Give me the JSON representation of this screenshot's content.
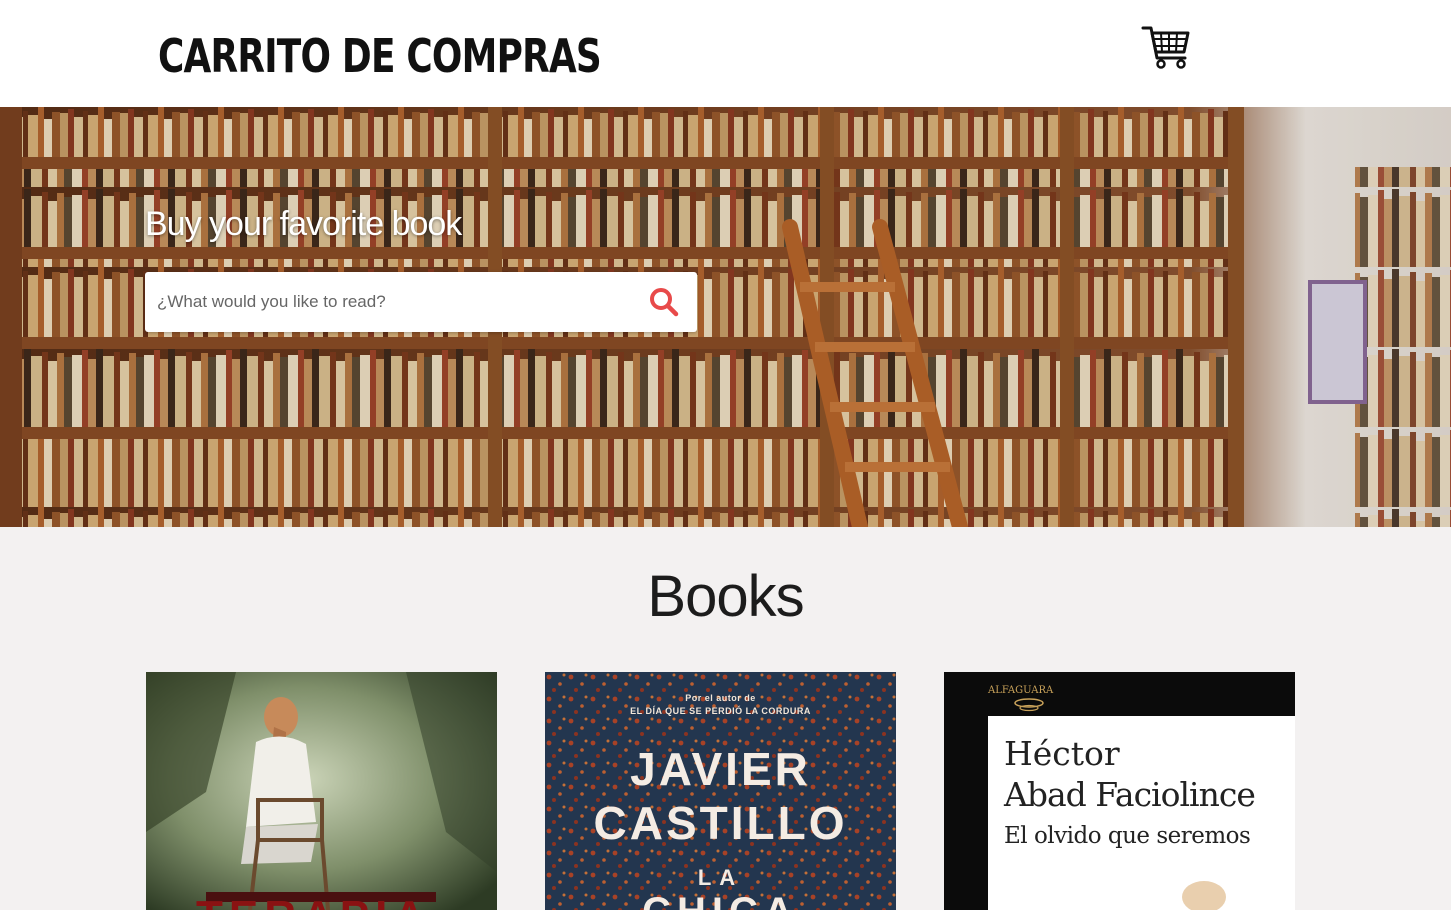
{
  "header": {
    "logo_text": "CARRITO DE COMPRAS",
    "cart_icon": "shopping-cart-icon"
  },
  "hero": {
    "title": "Buy your favorite book",
    "search": {
      "placeholder": "¿What would you like to read?",
      "value": "",
      "icon": "search-icon",
      "icon_color": "#e84a4a"
    }
  },
  "books_section": {
    "title": "Books",
    "books": [
      {
        "cover_title_partial": "TERAPIA"
      },
      {
        "cover_small_line1": "Por el autor de",
        "cover_small_line2": "EL DÍA QUE SE PERDIÓ LA CORDURA",
        "cover_author_line1": "JAVIER",
        "cover_author_line2": "CASTILLO",
        "cover_title_line1": "LA",
        "cover_title_line2": "CHICA"
      },
      {
        "publisher": "ALFAGUARA",
        "cover_author_line1": "Héctor",
        "cover_author_line2": "Abad Faciolince",
        "cover_title": "El olvido que seremos"
      }
    ]
  },
  "colors": {
    "header_bg": "#ffffff",
    "page_bg": "#f3f1f1",
    "accent": "#e84a4a"
  }
}
